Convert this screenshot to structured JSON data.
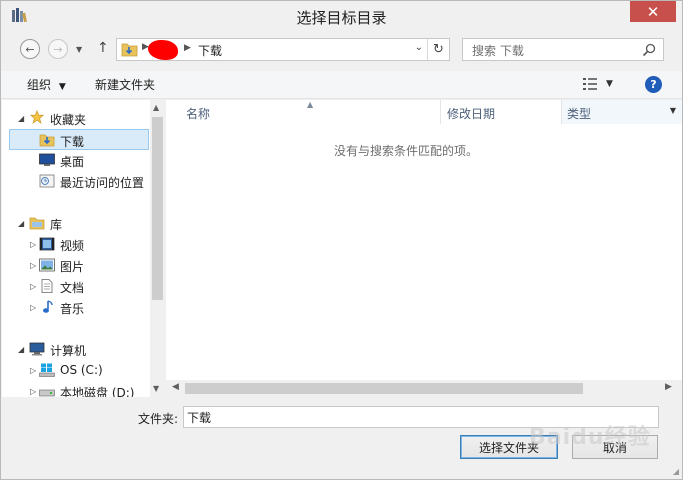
{
  "window": {
    "title": "选择目标目录",
    "close_glyph": "✕"
  },
  "addressbar": {
    "breadcrumb_current": "下载",
    "refresh_glyph": "↻"
  },
  "search": {
    "placeholder": "搜索 下载"
  },
  "toolbar": {
    "organize_label": "组织",
    "new_folder_label": "新建文件夹",
    "help_glyph": "?"
  },
  "navpane": {
    "favorites": {
      "label": "收藏夹",
      "items": [
        {
          "label": "下载",
          "icon": "download-folder-icon"
        },
        {
          "label": "桌面",
          "icon": "desktop-icon"
        },
        {
          "label": "最近访问的位置",
          "icon": "recent-places-icon"
        }
      ]
    },
    "libraries": {
      "label": "库",
      "items": [
        {
          "label": "视频",
          "icon": "video-library-icon"
        },
        {
          "label": "图片",
          "icon": "pictures-library-icon"
        },
        {
          "label": "文档",
          "icon": "documents-library-icon"
        },
        {
          "label": "音乐",
          "icon": "music-library-icon"
        }
      ]
    },
    "computer": {
      "label": "计算机",
      "items": [
        {
          "label": "OS (C:)",
          "icon": "os-drive-icon"
        },
        {
          "label": "本地磁盘 (D:)",
          "icon": "local-disk-icon"
        }
      ]
    }
  },
  "filelist": {
    "columns": [
      "名称",
      "修改日期",
      "类型"
    ],
    "empty_message": "没有与搜索条件匹配的项。"
  },
  "footer": {
    "folder_label": "文件夹:",
    "folder_value": "下载",
    "select_button": "选择文件夹",
    "cancel_button": "取消"
  },
  "watermark": "Baidu经验",
  "colors": {
    "close_red": "#c7504c",
    "selection": "#d9ebf9",
    "help_blue": "#1f5db8"
  }
}
